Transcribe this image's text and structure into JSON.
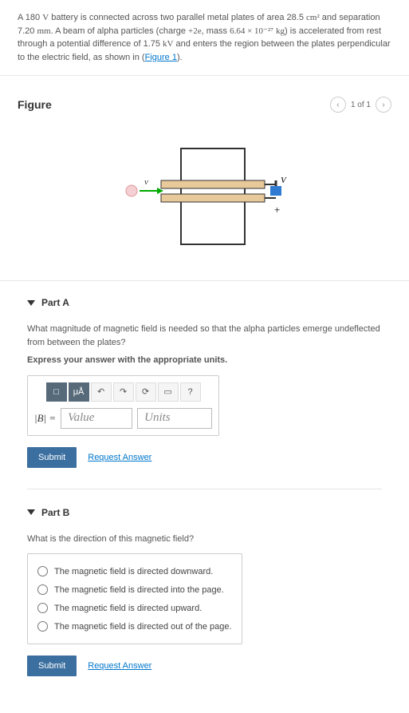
{
  "problem": {
    "text_a": "A 180 ",
    "unit_v": "V",
    "text_b": " battery is connected across two parallel metal plates of area 28.5 ",
    "unit_cm2": "cm²",
    "text_c": " and separation 7.20 ",
    "unit_mm": "mm",
    "text_d": ". A beam of alpha particles (charge ",
    "q": "+2e",
    "text_e": ", mass ",
    "mass": "6.64 × 10⁻²⁷",
    "unit_kg": "kg",
    "text_f": ") is accelerated from rest through a potential difference of 1.75 ",
    "unit_kv": "kV",
    "text_g": " and enters the region between the plates perpendicular to the electric field, as shown in (",
    "fig_link": "Figure 1",
    "text_h": ")."
  },
  "figure": {
    "title": "Figure",
    "pager": "1 of 1",
    "labels": {
      "vel": "v",
      "volt": "V",
      "plus": "+"
    }
  },
  "partA": {
    "title": "Part A",
    "prompt": "What magnitude of magnetic field is needed so that the alpha particles emerge undeflected from between the plates?",
    "hint": "Express your answer with the appropriate units.",
    "toolbar": {
      "expr": "□",
      "ua": "μÅ",
      "undo": "↶",
      "redo": "↷",
      "reset": "⟳",
      "kb": "▭",
      "help": "?"
    },
    "lhs": "|B| =",
    "value_ph": "Value",
    "units_ph": "Units",
    "submit": "Submit",
    "request": "Request Answer"
  },
  "partB": {
    "title": "Part B",
    "prompt": "What is the direction of this magnetic field?",
    "options": [
      "The magnetic field is directed downward.",
      "The magnetic field is directed into the page.",
      "The magnetic field is directed upward.",
      "The magnetic field is directed out of the page."
    ],
    "submit": "Submit",
    "request": "Request Answer"
  }
}
